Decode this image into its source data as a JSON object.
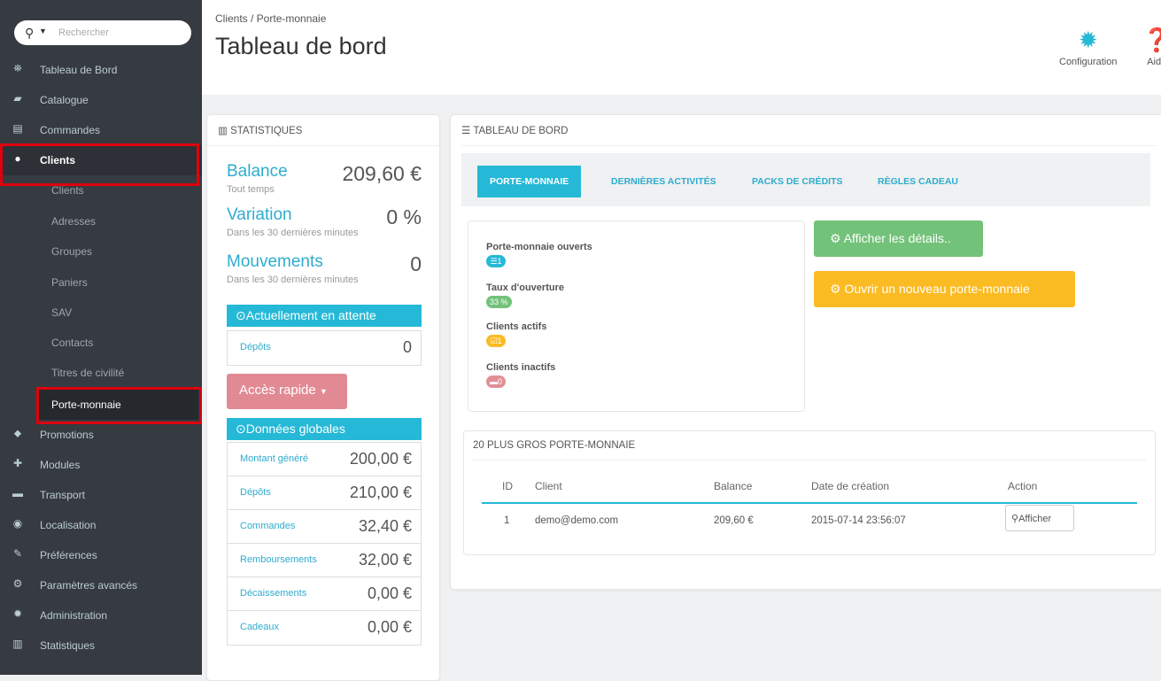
{
  "sidebar": {
    "search_placeholder": "Rechercher",
    "items": [
      {
        "label": "Tableau de Bord",
        "icon": "dashboard-icon",
        "glyph": "⛯"
      },
      {
        "label": "Catalogue",
        "icon": "book-icon",
        "glyph": "▰"
      },
      {
        "label": "Commandes",
        "icon": "credit-card-icon",
        "glyph": "▤"
      },
      {
        "label": "Clients",
        "icon": "users-icon",
        "glyph": "👥"
      }
    ],
    "subitems": [
      "Clients",
      "Adresses",
      "Groupes",
      "Paniers",
      "SAV",
      "Contacts",
      "Titres de civilité",
      "Porte-monnaie"
    ],
    "items_after": [
      {
        "label": "Promotions",
        "icon": "tags-icon",
        "glyph": "⬥"
      },
      {
        "label": "Modules",
        "icon": "puzzle-icon",
        "glyph": "✚"
      },
      {
        "label": "Transport",
        "icon": "truck-icon",
        "glyph": "▬"
      },
      {
        "label": "Localisation",
        "icon": "globe-icon",
        "glyph": "◉"
      },
      {
        "label": "Préférences",
        "icon": "wrench-icon",
        "glyph": "✎"
      },
      {
        "label": "Paramètres avancés",
        "icon": "cogs-icon",
        "glyph": "⚙"
      },
      {
        "label": "Administration",
        "icon": "cog-icon",
        "glyph": "✹"
      },
      {
        "label": "Statistiques",
        "icon": "bar-chart-icon",
        "glyph": "▥"
      }
    ]
  },
  "header": {
    "breadcrumb": "Clients  /  Porte-monnaie",
    "title": "Tableau de bord",
    "config_label": "Configuration",
    "help_label": "Aide"
  },
  "stats": {
    "heading": "STATISTIQUES",
    "balance_label": "Balance",
    "balance_value": "209,60 €",
    "balance_sub": "Tout temps",
    "variation_label": "Variation",
    "variation_value": "0 %",
    "variation_sub": "Dans les 30 dernières minutes",
    "mouvements_label": "Mouvements",
    "mouvements_value": "0",
    "mouvements_sub": "Dans les 30 dernières minutes",
    "pending_heading": "Actuellement en attente",
    "pending_rows": [
      {
        "label": "Dépôts",
        "value": "0"
      }
    ],
    "quick_access": "Accès rapide",
    "global_heading": "Données globales",
    "global_rows": [
      {
        "label": "Montant généré",
        "value": "200,00 €"
      },
      {
        "label": "Dépôts",
        "value": "210,00 €"
      },
      {
        "label": "Commandes",
        "value": "32,40 €"
      },
      {
        "label": "Remboursements",
        "value": "32,00 €"
      },
      {
        "label": "Décaissements",
        "value": "0,00 €"
      },
      {
        "label": "Cadeaux",
        "value": "0,00 €"
      }
    ]
  },
  "dashboard": {
    "heading": "TABLEAU DE BORD",
    "tabs": [
      "PORTE-MONNAIE",
      "DERNIÈRES ACTIVITÉS",
      "PACKS DE CRÉDITS",
      "RÈGLES CADEAU"
    ],
    "metrics": [
      {
        "label": "Porte-monnaie ouverts",
        "badge": "1",
        "color": "#25b9d7"
      },
      {
        "label": "Taux d'ouverture",
        "badge": "33 %",
        "color": "#72c279"
      },
      {
        "label": "Clients actifs",
        "badge": "1",
        "color": "#fbbb22"
      },
      {
        "label": "Clients inactifs",
        "badge": "0",
        "color": "#e08f95"
      }
    ],
    "details_button": "Afficher les détails..",
    "new_wallet_button": "Ouvrir un nouveau porte-monnaie",
    "top_heading": "20 PLUS GROS PORTE-MONNAIE",
    "columns": [
      "ID",
      "Client",
      "Balance",
      "Date de création",
      "Action"
    ],
    "rows": [
      {
        "id": "1",
        "client": "demo@demo.com",
        "balance": "209,60 €",
        "date": "2015-07-14 23:56:07",
        "action": "Afficher"
      }
    ]
  }
}
